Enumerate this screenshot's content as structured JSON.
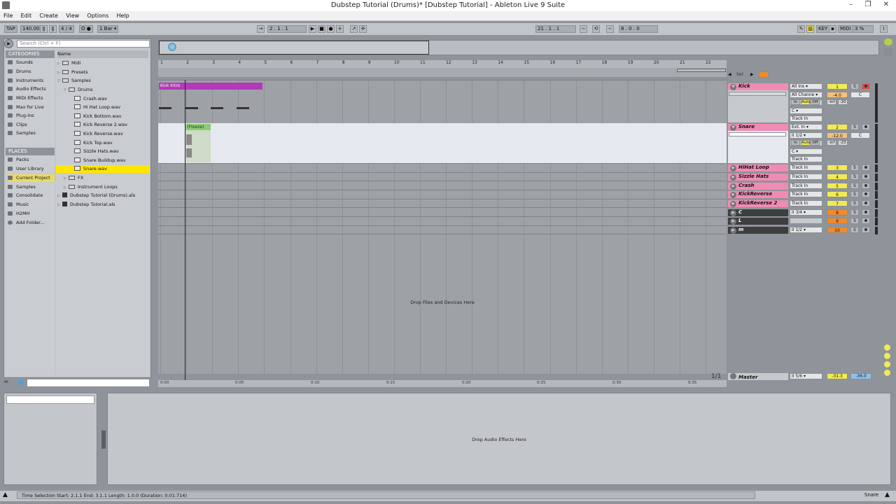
{
  "window": {
    "title": "Dubstep Tutorial (Drums)*  [Dubstep Tutorial] - Ableton Live 9 Suite",
    "minimize": "–",
    "restore": "❐",
    "close": "✕"
  },
  "menu": [
    "File",
    "Edit",
    "Create",
    "View",
    "Options",
    "Help"
  ],
  "control_bar": {
    "tap": "TAP",
    "tempo": "140.00",
    "time_sig": "4 / 4",
    "metronome": "O ●",
    "quantize": "1 Bar ▾",
    "song_position": "2 .  1 .  1",
    "loop_start": "21 .  1 .  1",
    "loop_length": "8 .  0 .  0",
    "key": "KEY",
    "midi": "MIDI",
    "cpu": "3 %"
  },
  "browser": {
    "search_placeholder": "Search (Ctrl + F)",
    "categories_header": "CATEGORIES",
    "categories": [
      "Sounds",
      "Drums",
      "Instruments",
      "Audio Effects",
      "MIDI Effects",
      "Max for Live",
      "Plug-ins",
      "Clips",
      "Samples"
    ],
    "places_header": "PLACES",
    "places": [
      "Packs",
      "User Library",
      "Current Project",
      "Samples",
      "Consolidate",
      "Music",
      "H2MH",
      "Add Folder..."
    ],
    "selected_place": "Current Project",
    "name_header": "Name",
    "tree": [
      {
        "label": "Midi",
        "type": "folder",
        "indent": 0,
        "arrow": "▷"
      },
      {
        "label": "Presets",
        "type": "folder",
        "indent": 0,
        "arrow": "▷"
      },
      {
        "label": "Samples",
        "type": "folder",
        "indent": 0,
        "arrow": "▽"
      },
      {
        "label": "Drums",
        "type": "folder",
        "indent": 1,
        "arrow": "▽"
      },
      {
        "label": "Crash.wav",
        "type": "wav",
        "indent": 2,
        "arrow": ""
      },
      {
        "label": "Hi Hat Loop.wav",
        "type": "wav",
        "indent": 2,
        "arrow": ""
      },
      {
        "label": "Kick Bottom.wav",
        "type": "wav",
        "indent": 2,
        "arrow": ""
      },
      {
        "label": "Kick Reverse 2.wav",
        "type": "wav",
        "indent": 2,
        "arrow": ""
      },
      {
        "label": "Kick Reverse.wav",
        "type": "wav",
        "indent": 2,
        "arrow": ""
      },
      {
        "label": "Kick Top.wav",
        "type": "wav",
        "indent": 2,
        "arrow": ""
      },
      {
        "label": "Sizzle Hats.wav",
        "type": "wav",
        "indent": 2,
        "arrow": ""
      },
      {
        "label": "Snare Buildup.wav",
        "type": "wav",
        "indent": 2,
        "arrow": ""
      },
      {
        "label": "Snare.wav",
        "type": "wav",
        "indent": 2,
        "arrow": "",
        "selected": true
      },
      {
        "label": "FX",
        "type": "folder",
        "indent": 1,
        "arrow": "▷"
      },
      {
        "label": "Instrument Loops",
        "type": "folder",
        "indent": 1,
        "arrow": "▷"
      },
      {
        "label": "Dubstep Tutorial (Drums).als",
        "type": "als",
        "indent": 0,
        "arrow": "▷"
      },
      {
        "label": "Dubstep Tutorial.als",
        "type": "als",
        "indent": 0,
        "arrow": "▷"
      }
    ]
  },
  "arrangement": {
    "ruler_bars": [
      "1",
      "2",
      "3",
      "4",
      "5",
      "6",
      "7",
      "8",
      "9",
      "10",
      "11",
      "12",
      "13",
      "14",
      "15",
      "16",
      "17",
      "18",
      "19",
      "20",
      "21",
      "22"
    ],
    "clips": {
      "kick": "Kick Intro",
      "snare": "(Freeze)"
    },
    "drop_files": "Drop Files and Devices Here",
    "time_marks": [
      "0:00",
      "0:05",
      "0:10",
      "0:15",
      "0:20",
      "0:25",
      "0:30",
      "0:35"
    ]
  },
  "set_controls": {
    "set": "Set",
    "page": "1/1"
  },
  "tracks": [
    {
      "name": "Kick",
      "color": "#f08cb3",
      "io": [
        "All Ins ▾",
        "All Channe ▾",
        "",
        "C ▾",
        "Track In"
      ],
      "monitor": [
        "In",
        "Auto",
        "Off"
      ],
      "number": "1",
      "num_color": "#f2ea55",
      "vol": "-4.0",
      "pan": "C",
      "meter": [
        "-inf",
        "-20"
      ]
    },
    {
      "name": "Snare",
      "color": "#f08cb3",
      "io": [
        "Ext. In ▾",
        "II 1/2 ▾",
        "",
        "C ▾",
        "Track In"
      ],
      "monitor": [
        "In",
        "Auto",
        "Off"
      ],
      "number": "2",
      "num_color": "#f2ea55",
      "vol": "-12.0",
      "pan": "C",
      "meter": [
        "-inf",
        "-23"
      ]
    },
    {
      "name": "HiHat Loop",
      "color": "#f08cb3",
      "io": [
        "Track In"
      ],
      "number": "3",
      "num_color": "#f2ea55"
    },
    {
      "name": "Sizzle Hats",
      "color": "#f08cb3",
      "io": [
        "Track In"
      ],
      "number": "4",
      "num_color": "#f2ea55"
    },
    {
      "name": "Crash",
      "color": "#f08cb3",
      "io": [
        "Track In"
      ],
      "number": "5",
      "num_color": "#f2ea55"
    },
    {
      "name": "KickReverse",
      "color": "#f08cb3",
      "io": [
        "Track In"
      ],
      "number": "6",
      "num_color": "#f2ea55"
    },
    {
      "name": "KickReverse 2",
      "color": "#f08cb3",
      "io": [
        "Track In"
      ],
      "number": "7",
      "num_color": "#f2ea55"
    },
    {
      "name": "C",
      "color": "#3e3e3e",
      "io": [
        "II 3/4 ▾"
      ],
      "number": "8",
      "num_color": "#f08a2a"
    },
    {
      "name": "L",
      "color": "#3e3e3e",
      "io": [
        ""
      ],
      "number": "9",
      "num_color": "#f08a2a"
    },
    {
      "name": "m",
      "color": "#3e3e3e",
      "io": [
        "II 1/2 ▾"
      ],
      "number": "10",
      "num_color": "#f08a2a"
    }
  ],
  "master": {
    "name": "Master",
    "io": "II 5/6 ▾",
    "vol": "-31.3",
    "vol2": "-36.0"
  },
  "detail": {
    "drop_audio": "Drop Audio Effects Here"
  },
  "status": {
    "text": "Time Selection    Start: 2.1.1    End: 3.1.1    Length: 1.0.0  (Duration: 0:01:714)",
    "track_name": "Snare"
  }
}
